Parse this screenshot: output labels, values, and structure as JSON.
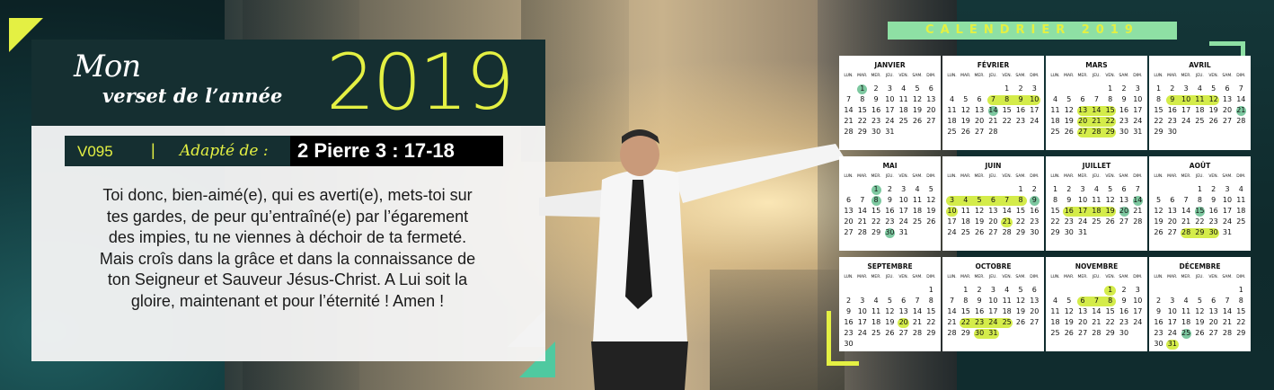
{
  "title": {
    "mon": "Mon",
    "verset": "verset de l’année",
    "year": "2019"
  },
  "reference": {
    "code": "V095",
    "separator": "|",
    "adapted": "Adapté de :",
    "verse": "2 Pierre 3 : 17-18"
  },
  "verse_lines": [
    "Toi donc, bien-aimé(e), qui es averti(e), mets-toi sur",
    "tes gardes, de peur qu’entraîné(e) par l’égarement",
    "des impies, tu ne viennes à déchoir de ta fermeté.",
    "Mais croîs dans la grâce et dans la connaissance de",
    "ton Seigneur et Sauveur Jésus-Christ. A Lui soit la",
    "gloire, maintenant et pour l’éternité ! Amen !"
  ],
  "calendar": {
    "title": "CALENDRIER 2019",
    "weekdays": [
      "LUN.",
      "MAR.",
      "MER.",
      "JEU.",
      "VEN.",
      "SAM.",
      "DIM."
    ],
    "months": [
      {
        "name": "JANVIER",
        "start": 1,
        "days": 31,
        "yellow": [],
        "green": [
          1
        ]
      },
      {
        "name": "FÉVRIER",
        "start": 4,
        "days": 28,
        "yellow": [
          7,
          8,
          9,
          10
        ],
        "green": [
          14
        ]
      },
      {
        "name": "MARS",
        "start": 4,
        "days": 31,
        "yellow": [
          13,
          14,
          15,
          20,
          21,
          22,
          27,
          28,
          29
        ],
        "green": []
      },
      {
        "name": "AVRIL",
        "start": 0,
        "days": 30,
        "yellow": [
          9,
          10,
          11,
          12
        ],
        "green": [
          21
        ]
      },
      {
        "name": "MAI",
        "start": 2,
        "days": 31,
        "yellow": [],
        "green": [
          1,
          8,
          30
        ]
      },
      {
        "name": "JUIN",
        "start": 5,
        "days": 30,
        "yellow": [
          3,
          4,
          5,
          6,
          7,
          8,
          10,
          21
        ],
        "green": [
          9
        ]
      },
      {
        "name": "JUILLET",
        "start": 0,
        "days": 31,
        "yellow": [
          16,
          17,
          18,
          19
        ],
        "green": [
          14,
          20
        ]
      },
      {
        "name": "AOÛT",
        "start": 3,
        "days": 31,
        "yellow": [
          28,
          29,
          30
        ],
        "green": [
          15
        ]
      },
      {
        "name": "SEPTEMBRE",
        "start": 6,
        "days": 30,
        "yellow": [
          20
        ],
        "green": []
      },
      {
        "name": "OCTOBRE",
        "start": 1,
        "days": 31,
        "yellow": [
          22,
          23,
          24,
          25,
          30,
          31
        ],
        "green": []
      },
      {
        "name": "NOVEMBRE",
        "start": 4,
        "days": 30,
        "yellow": [
          1,
          6,
          7,
          8
        ],
        "green": []
      },
      {
        "name": "DÉCEMBRE",
        "start": 6,
        "days": 31,
        "yellow": [
          31
        ],
        "green": [
          25
        ]
      }
    ]
  },
  "colors": {
    "accent_yellow": "#e4f043",
    "accent_green": "#8ee0a4",
    "panel_dark": "#152f31"
  }
}
